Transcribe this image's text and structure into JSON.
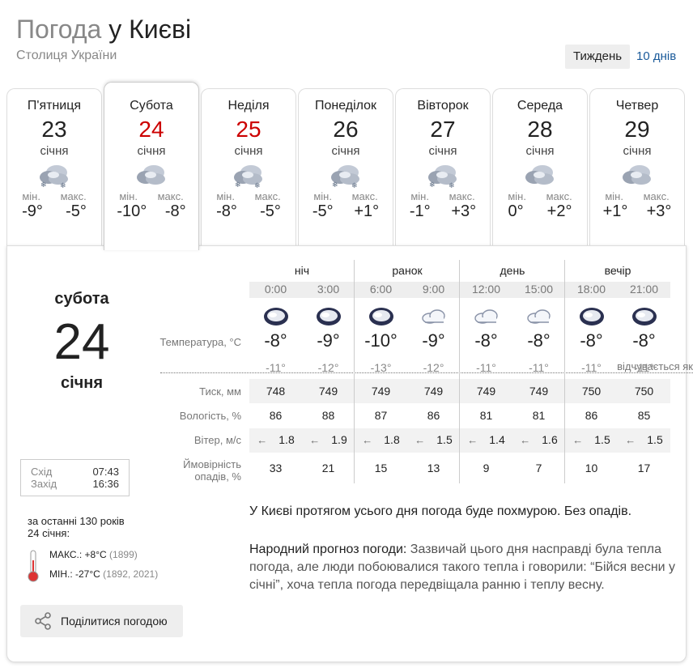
{
  "header": {
    "title_part1": "Погода",
    "title_part2": "у Києві",
    "subtitle": "Столиця України",
    "btn_week": "Тиждень",
    "btn_10days": "10 днів"
  },
  "days": [
    {
      "name": "П'ятниця",
      "num": "23",
      "month": "січня",
      "icon": "cloudy-snow-icon",
      "min_label": "мін.",
      "max_label": "макс.",
      "min": "-9°",
      "max": "-5°",
      "weekend": false
    },
    {
      "name": "Субота",
      "num": "24",
      "month": "січня",
      "icon": "cloudy-icon",
      "min_label": "мін.",
      "max_label": "макс.",
      "min": "-10°",
      "max": "-8°",
      "weekend": true
    },
    {
      "name": "Неділя",
      "num": "25",
      "month": "січня",
      "icon": "cloudy-snow-icon",
      "min_label": "мін.",
      "max_label": "макс.",
      "min": "-8°",
      "max": "-5°",
      "weekend": true
    },
    {
      "name": "Понеділок",
      "num": "26",
      "month": "січня",
      "icon": "cloudy-snow-icon",
      "min_label": "мін.",
      "max_label": "макс.",
      "min": "-5°",
      "max": "+1°",
      "weekend": false
    },
    {
      "name": "Вівторок",
      "num": "27",
      "month": "січня",
      "icon": "cloudy-snow-icon",
      "min_label": "мін.",
      "max_label": "макс.",
      "min": "-1°",
      "max": "+3°",
      "weekend": false
    },
    {
      "name": "Середа",
      "num": "28",
      "month": "січня",
      "icon": "cloudy-icon",
      "min_label": "мін.",
      "max_label": "макс.",
      "min": "0°",
      "max": "+2°",
      "weekend": false
    },
    {
      "name": "Четвер",
      "num": "29",
      "month": "січня",
      "icon": "cloudy-icon",
      "min_label": "мін.",
      "max_label": "макс.",
      "min": "+1°",
      "max": "+3°",
      "weekend": false
    }
  ],
  "selected_day": {
    "weekday": "субота",
    "num": "24",
    "month": "січня"
  },
  "sun": {
    "rise_label": "Схід",
    "rise": "07:43",
    "set_label": "Захід",
    "set": "16:36"
  },
  "history": {
    "line1": "за останні 130 років",
    "line2": "24 січня:",
    "max_label": "МАКС.:",
    "max_value": "+8°C",
    "max_year": "(1899)",
    "min_label": "МІН.:",
    "min_value": "-27°C",
    "min_year": "(1892, 2021)"
  },
  "share_label": "Поділитися погодою",
  "row_labels": {
    "temp": "Температура, °С",
    "feels": "відчувається як",
    "pressure": "Тиск, мм",
    "humidity": "Вологість, %",
    "wind": "Вітер, м/с",
    "precip1": "Ймовірність",
    "precip2": "опадів, %"
  },
  "periods": [
    "ніч",
    "ранок",
    "день",
    "вечір"
  ],
  "hours": [
    {
      "time": "0:00",
      "icon": "overcast-icon",
      "temp": "-8°",
      "feel": "-11°",
      "pressure": "748",
      "humidity": "86",
      "wind": "1.8",
      "precip": "33"
    },
    {
      "time": "3:00",
      "icon": "overcast-icon",
      "temp": "-9°",
      "feel": "-12°",
      "pressure": "749",
      "humidity": "88",
      "wind": "1.9",
      "precip": "21"
    },
    {
      "time": "6:00",
      "icon": "overcast-icon",
      "temp": "-10°",
      "feel": "-13°",
      "pressure": "749",
      "humidity": "87",
      "wind": "1.8",
      "precip": "15"
    },
    {
      "time": "9:00",
      "icon": "light-cloud-icon",
      "temp": "-9°",
      "feel": "-12°",
      "pressure": "749",
      "humidity": "86",
      "wind": "1.5",
      "precip": "13"
    },
    {
      "time": "12:00",
      "icon": "light-cloud-icon",
      "temp": "-8°",
      "feel": "-11°",
      "pressure": "749",
      "humidity": "81",
      "wind": "1.4",
      "precip": "9"
    },
    {
      "time": "15:00",
      "icon": "light-cloud-icon",
      "temp": "-8°",
      "feel": "-11°",
      "pressure": "749",
      "humidity": "81",
      "wind": "1.6",
      "precip": "7"
    },
    {
      "time": "18:00",
      "icon": "overcast-icon",
      "temp": "-8°",
      "feel": "-11°",
      "pressure": "750",
      "humidity": "86",
      "wind": "1.5",
      "precip": "10"
    },
    {
      "time": "21:00",
      "icon": "overcast-icon",
      "temp": "-8°",
      "feel": "-11°",
      "pressure": "750",
      "humidity": "85",
      "wind": "1.5",
      "precip": "17"
    }
  ],
  "wind_arrow": "←",
  "description": "У Києві протягом усього дня погода буде похмурою. Без опадів.",
  "folk": {
    "label": "Народний прогноз погоди:",
    "text": " Зазвичай цього дня насправді була тепла погода, але люди побоювалися такого тепла і говорили: “Бійся весни у січні”, хоча тепла погода передвіщала ранню і теплу весну."
  },
  "colors": {
    "weekend": "#cc0000",
    "link": "#1a5a9a",
    "cloud_dark": "#2a3050"
  }
}
